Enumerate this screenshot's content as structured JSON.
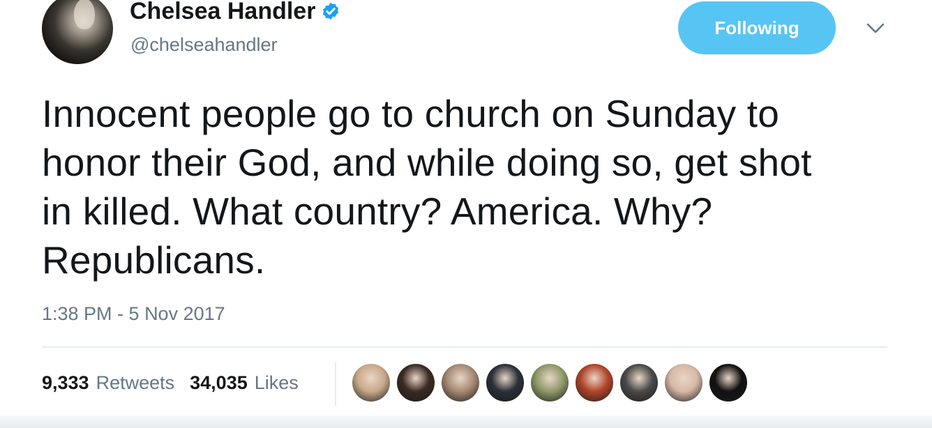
{
  "author": {
    "display_name": "Chelsea Handler",
    "handle": "@chelseahandler",
    "verified_icon": "verified-badge-icon"
  },
  "follow_button": {
    "label": "Following",
    "color": "#57c5f3"
  },
  "tweet": {
    "text": "Innocent people go to church on Sunday to\nhonor their God, and while doing so, get shot\nin killed. What country? America. Why?\nRepublicans.",
    "timestamp": "1:38 PM - 5 Nov 2017"
  },
  "stats": {
    "retweets_count": "9,333",
    "retweets_label": "Retweets",
    "likes_count": "34,035",
    "likes_label": "Likes"
  },
  "likers": [
    {
      "name": "liker-avatar-1",
      "color": "#c9a98a"
    },
    {
      "name": "liker-avatar-2",
      "color": "#3a2a22"
    },
    {
      "name": "liker-avatar-3",
      "color": "#a68a74"
    },
    {
      "name": "liker-avatar-4",
      "color": "#2b2f3a"
    },
    {
      "name": "liker-avatar-5",
      "color": "#8f9a6a"
    },
    {
      "name": "liker-avatar-6",
      "color": "#b0452a"
    },
    {
      "name": "liker-avatar-7",
      "color": "#4a4a4a"
    },
    {
      "name": "liker-avatar-8",
      "color": "#d7b8a6"
    },
    {
      "name": "liker-avatar-9",
      "color": "#111111"
    }
  ],
  "colors": {
    "text_primary": "#14171a",
    "text_secondary": "#657786",
    "verified_blue": "#1da1f2"
  }
}
